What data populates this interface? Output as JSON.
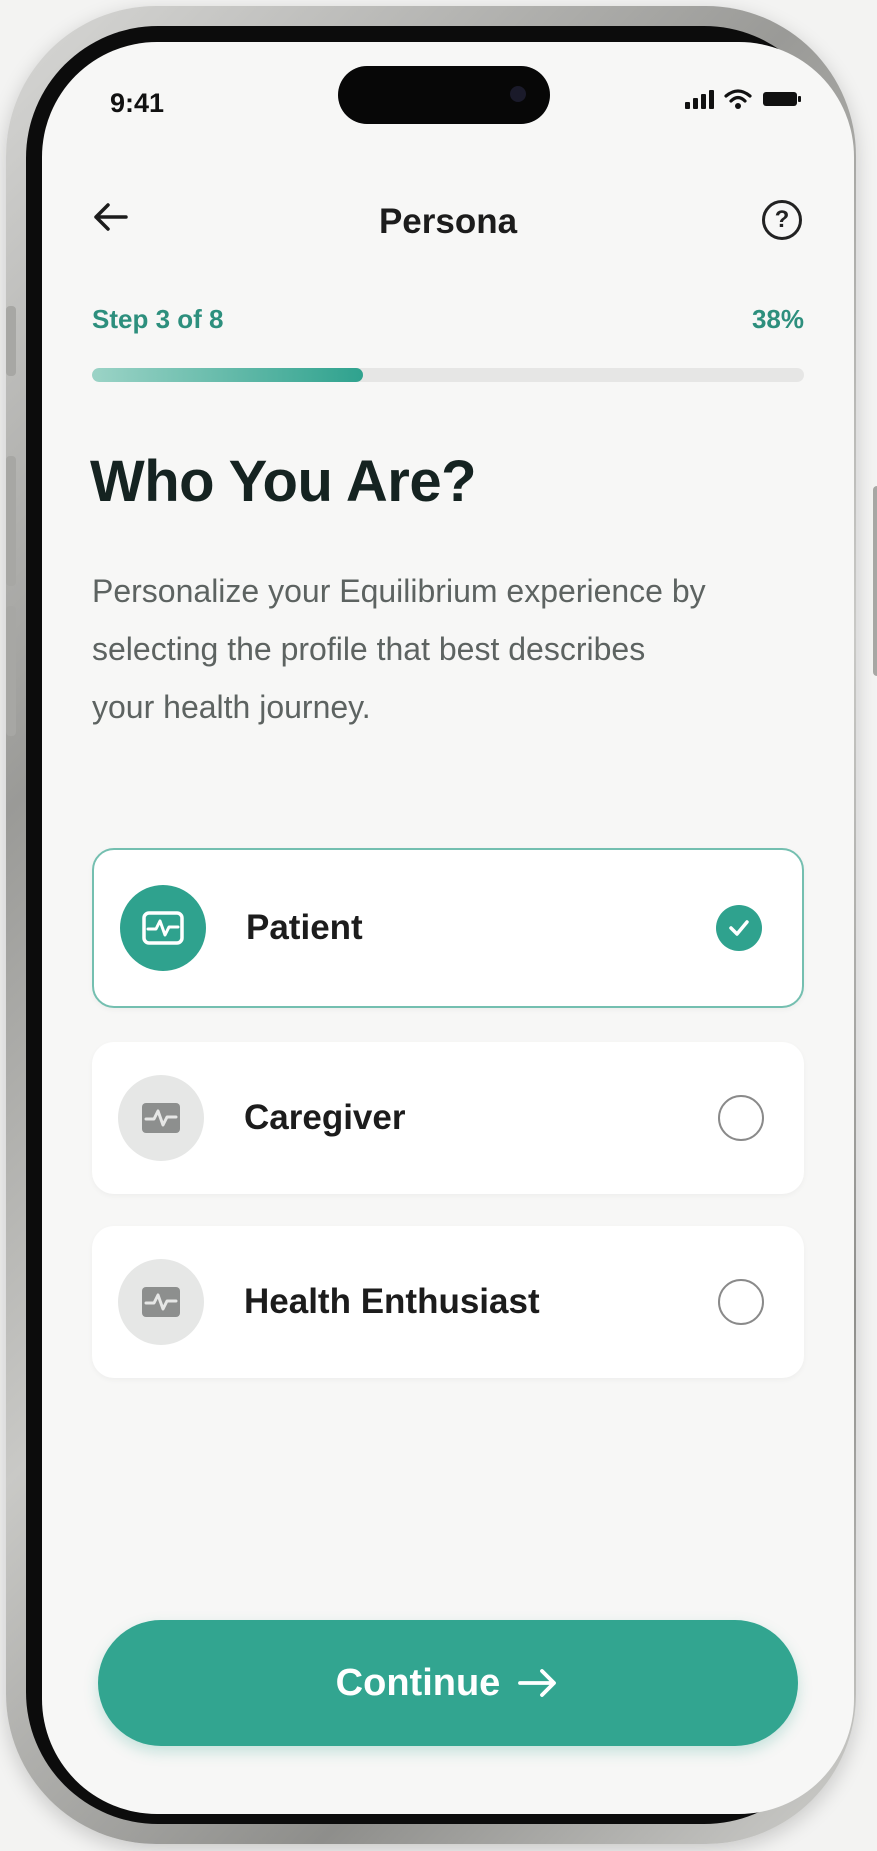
{
  "status_bar": {
    "time": "9:41",
    "icons": [
      "signal-icon",
      "wifi-icon",
      "battery-icon"
    ]
  },
  "nav": {
    "title": "Persona",
    "back_icon": "arrow-left-icon",
    "help_glyph": "?"
  },
  "progress": {
    "step_label": "Step 3 of 8",
    "percent_label": "38%",
    "fraction": 0.38
  },
  "headline": "Who You Are?",
  "subtext": "Personalize your Equilibrium experience by selecting the profile that best describes your health journey.",
  "options": [
    {
      "label": "Patient",
      "selected": true,
      "icon": "heartbeat-monitor-icon"
    },
    {
      "label": "Caregiver",
      "selected": false,
      "icon": "heartbeat-monitor-icon"
    },
    {
      "label": "Health Enthusiast",
      "selected": false,
      "icon": "heartbeat-monitor-icon"
    }
  ],
  "cta": {
    "label": "Continue",
    "icon": "arrow-right-icon"
  },
  "colors": {
    "accent": "#2fa28e",
    "accent_light": "#9bd3c6",
    "headline": "#152321",
    "body_text": "#5d6361"
  }
}
